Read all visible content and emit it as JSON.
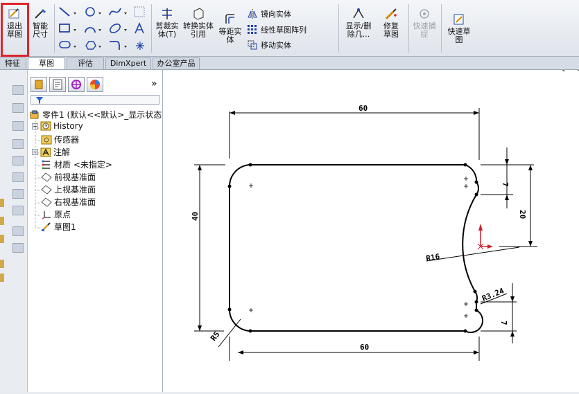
{
  "ribbon": {
    "exit_sketch": "退出草图",
    "smart_dim": "智能尺寸",
    "trim": "剪裁实体(T)",
    "convert": "转换实体引用",
    "offset": "等距实体",
    "mirror": "镜向实体",
    "linear_pattern": "线性草图阵列",
    "move": "移动实体",
    "show_delete": "显示/删除几...",
    "repair": "修复草图",
    "quick_snap": "快速捕捉",
    "rapid_sketch": "快速草图"
  },
  "tabs": [
    "特征",
    "草图",
    "评估",
    "DimXpert",
    "办公室产品"
  ],
  "tree": {
    "root": "零件1 (默认<<默认>_显示状态",
    "items": [
      "History",
      "传感器",
      "注解",
      "材质 <未指定>",
      "前视基准面",
      "上视基准面",
      "右视基准面",
      "原点",
      "草图1"
    ]
  },
  "panel": {
    "more": "»"
  },
  "sketch": {
    "dims": {
      "top": "60",
      "bottom": "60",
      "left": "40",
      "right_top": "7",
      "right_mid": "20",
      "right_bottom": "7",
      "r16": "R16",
      "r3": "R3.24",
      "r5": "R5"
    }
  },
  "colors": {
    "highlight": "#e0242b",
    "origin_red": "#d0202a"
  }
}
